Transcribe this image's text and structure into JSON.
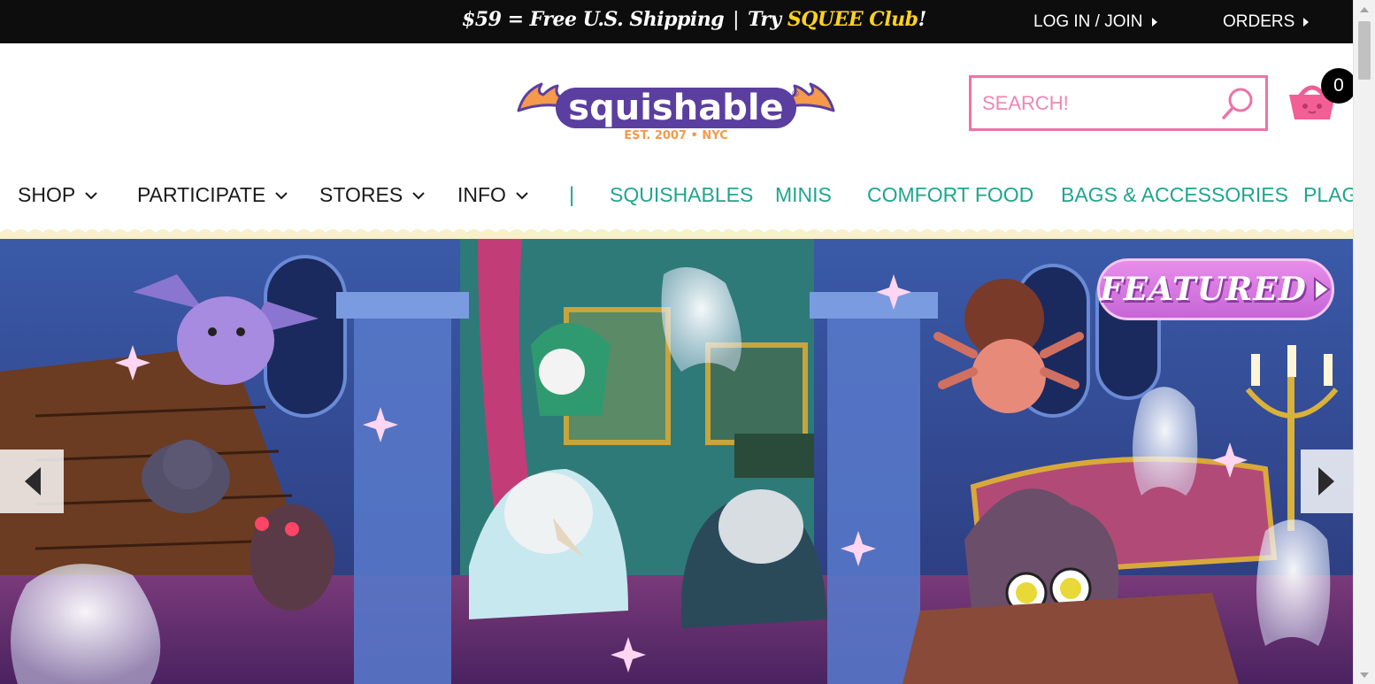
{
  "topbar": {
    "promo_shipping": "$59 = Free U.S. Shipping",
    "promo_separator": "|",
    "promo_try": "Try ",
    "promo_club": "SQUEE Club",
    "promo_exclaim": "!",
    "login_label": "LOG IN / JOIN",
    "orders_label": "ORDERS"
  },
  "header": {
    "logo_name": "squishable",
    "logo_registered": "®",
    "logo_tagline": "EST. 2007 • NYC",
    "search_placeholder": "SEARCH!",
    "search_icon": "magnifier-icon",
    "cart_icon": "basket-icon",
    "cart_count": "0"
  },
  "nav": {
    "menus": [
      {
        "label": "SHOP"
      },
      {
        "label": "PARTICIPATE"
      },
      {
        "label": "STORES"
      },
      {
        "label": "INFO"
      }
    ],
    "separator": "|",
    "links": [
      {
        "label": "SQUISHABLES"
      },
      {
        "label": "MINIS"
      },
      {
        "label": "COMFORT FOOD"
      },
      {
        "label": "BAGS & ACCESSORIES"
      },
      {
        "label": "PLAGUE DOCTORS"
      }
    ]
  },
  "hero": {
    "featured_label": "FEATURED",
    "prev_icon": "chevron-left-icon",
    "next_icon": "chevron-right-icon"
  },
  "colors": {
    "topbar_bg": "#0d0d0d",
    "club_yellow": "#ffd21f",
    "search_pink": "#ee72a7",
    "nav_teal": "#1fa58f",
    "logo_purple": "#5a3ea0",
    "logo_orange": "#f49a4a"
  }
}
